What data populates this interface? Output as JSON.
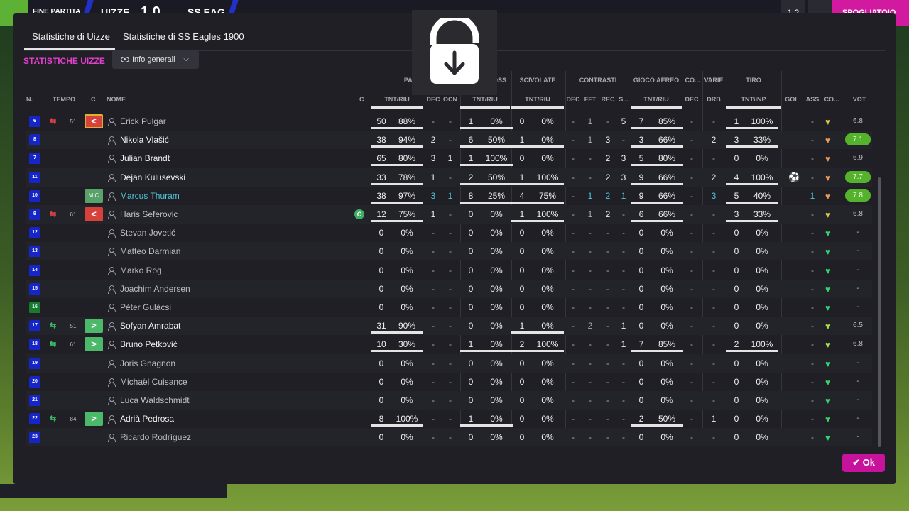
{
  "topbar": {
    "fine_partita": "FINE PARTITA",
    "home": "UIZZE",
    "score": "1 0",
    "away": "SS EAG",
    "right_btn1": "1 2",
    "right_btn2": "⌄",
    "right_label": "SPOGLIATOIO"
  },
  "tabs": [
    {
      "label": "Statistiche di Uizze"
    },
    {
      "label": "Statistiche di SS Eagles 1900"
    }
  ],
  "section_title": "STATISTICHE UIZZE",
  "view_dropdown": {
    "selected": "Info generali"
  },
  "column_groups": [
    "PASSAGG",
    "CROSS",
    "SCIVOLATE",
    "CONTRASTI",
    "GIOCO AEREO",
    "CO...",
    "VARIE",
    "TIRO"
  ],
  "columns": [
    "N.",
    "TEMPO",
    "C",
    "NOME",
    "C",
    "TNT/RIU",
    "DEC",
    "OCN",
    "TNT/RIU",
    "TNT/RIU",
    "DEC",
    "FFT",
    "REC",
    "S...",
    "TNT/RIU",
    "DEC",
    "DRB",
    "TNT\\INP",
    "GOL",
    "ASS",
    "CO...",
    "VOT"
  ],
  "players": [
    {
      "num": "6",
      "sub": "out",
      "time": "51",
      "chip": "<",
      "name": "Erick Pulgar",
      "pass": [
        "50",
        "88%"
      ],
      "dec": "-",
      "ocn": "-",
      "cross": [
        "1",
        "0%"
      ],
      "sciv": [
        "0",
        "0%"
      ],
      "cdec": "-",
      "fft": "1",
      "rec": "-",
      "s": "5",
      "aer": [
        "7",
        "85%"
      ],
      "codec": "-",
      "drb": "-",
      "tiro": [
        "1",
        "100%"
      ],
      "gol": "",
      "ass": "-",
      "rating": "6.8",
      "heart": "y"
    },
    {
      "num": "8",
      "sub": "",
      "time": "",
      "chip": "",
      "name": "Nikola Vlašić",
      "pass": [
        "38",
        "94%"
      ],
      "dec": "2",
      "ocn": "-",
      "cross": [
        "6",
        "50%"
      ],
      "sciv": [
        "1",
        "0%"
      ],
      "cdec": "-",
      "fft": "1",
      "rec": "3",
      "s": "-",
      "aer": [
        "3",
        "66%"
      ],
      "codec": "-",
      "drb": "2",
      "tiro": [
        "3",
        "33%"
      ],
      "gol": "",
      "ass": "-",
      "rating": "7.1",
      "heart": "o"
    },
    {
      "num": "7",
      "sub": "",
      "time": "",
      "chip": "",
      "name": "Julian Brandt",
      "pass": [
        "65",
        "80%"
      ],
      "dec": "3",
      "ocn": "1",
      "cross": [
        "1",
        "100%"
      ],
      "sciv": [
        "0",
        "0%"
      ],
      "cdec": "-",
      "fft": "-",
      "rec": "2",
      "s": "3",
      "aer": [
        "5",
        "80%"
      ],
      "codec": "-",
      "drb": "-",
      "tiro": [
        "0",
        "0%"
      ],
      "gol": "",
      "ass": "-",
      "rating": "6.9",
      "heart": "o"
    },
    {
      "num": "11",
      "sub": "",
      "time": "",
      "chip": "",
      "name": "Dejan Kulusevski",
      "pass": [
        "33",
        "78%"
      ],
      "dec": "1",
      "ocn": "-",
      "cross": [
        "2",
        "50%"
      ],
      "sciv": [
        "1",
        "100%"
      ],
      "cdec": "-",
      "fft": "-",
      "rec": "2",
      "s": "3",
      "aer": [
        "9",
        "66%"
      ],
      "codec": "-",
      "drb": "2",
      "tiro": [
        "4",
        "100%"
      ],
      "gol": "⚽",
      "ass": "-",
      "rating": "7.7",
      "heart": "o"
    },
    {
      "num": "10",
      "sub": "",
      "time": "",
      "chip": "MIC",
      "name": "Marcus Thuram",
      "pass": [
        "38",
        "97%"
      ],
      "dec": "3",
      "ocn": "1",
      "cross": [
        "8",
        "25%"
      ],
      "sciv": [
        "4",
        "75%"
      ],
      "cdec": "-",
      "fft": "1",
      "rec": "2",
      "s": "1",
      "aer": [
        "9",
        "66%"
      ],
      "codec": "-",
      "drb": "3",
      "tiro": [
        "5",
        "40%"
      ],
      "gol": "",
      "ass": "1",
      "rating": "7.8",
      "heart": "o"
    },
    {
      "num": "9",
      "sub": "out",
      "time": "61",
      "chip": "<",
      "name": "Haris Seferovic",
      "capt": "C",
      "pass": [
        "12",
        "75%"
      ],
      "dec": "1",
      "ocn": "-",
      "cross": [
        "0",
        "0%"
      ],
      "sciv": [
        "1",
        "100%"
      ],
      "cdec": "-",
      "fft": "1",
      "rec": "2",
      "s": "-",
      "aer": [
        "6",
        "66%"
      ],
      "codec": "-",
      "drb": "-",
      "tiro": [
        "3",
        "33%"
      ],
      "gol": "",
      "ass": "-",
      "rating": "6.8",
      "heart": "y"
    },
    {
      "num": "12",
      "sub": "",
      "time": "",
      "chip": "",
      "name": "Stevan Jovetić",
      "pass": [
        "0",
        "0%"
      ],
      "dec": "-",
      "ocn": "-",
      "cross": [
        "0",
        "0%"
      ],
      "sciv": [
        "0",
        "0%"
      ],
      "cdec": "-",
      "fft": "-",
      "rec": "-",
      "s": "-",
      "aer": [
        "0",
        "0%"
      ],
      "codec": "-",
      "drb": "-",
      "tiro": [
        "0",
        "0%"
      ],
      "gol": "",
      "ass": "-",
      "rating": "-",
      "heart": "g"
    },
    {
      "num": "13",
      "sub": "",
      "time": "",
      "chip": "",
      "name": "Matteo Darmian",
      "pass": [
        "0",
        "0%"
      ],
      "dec": "-",
      "ocn": "-",
      "cross": [
        "0",
        "0%"
      ],
      "sciv": [
        "0",
        "0%"
      ],
      "cdec": "-",
      "fft": "-",
      "rec": "-",
      "s": "-",
      "aer": [
        "0",
        "0%"
      ],
      "codec": "-",
      "drb": "-",
      "tiro": [
        "0",
        "0%"
      ],
      "gol": "",
      "ass": "-",
      "rating": "-",
      "heart": "g"
    },
    {
      "num": "14",
      "sub": "",
      "time": "",
      "chip": "",
      "name": "Marko Rog",
      "pass": [
        "0",
        "0%"
      ],
      "dec": "-",
      "ocn": "-",
      "cross": [
        "0",
        "0%"
      ],
      "sciv": [
        "0",
        "0%"
      ],
      "cdec": "-",
      "fft": "-",
      "rec": "-",
      "s": "-",
      "aer": [
        "0",
        "0%"
      ],
      "codec": "-",
      "drb": "-",
      "tiro": [
        "0",
        "0%"
      ],
      "gol": "",
      "ass": "-",
      "rating": "-",
      "heart": "g"
    },
    {
      "num": "15",
      "sub": "",
      "time": "",
      "chip": "",
      "name": "Joachim Andersen",
      "pass": [
        "0",
        "0%"
      ],
      "dec": "-",
      "ocn": "-",
      "cross": [
        "0",
        "0%"
      ],
      "sciv": [
        "0",
        "0%"
      ],
      "cdec": "-",
      "fft": "-",
      "rec": "-",
      "s": "-",
      "aer": [
        "0",
        "0%"
      ],
      "codec": "-",
      "drb": "-",
      "tiro": [
        "0",
        "0%"
      ],
      "gol": "",
      "ass": "-",
      "rating": "-",
      "heart": "g"
    },
    {
      "num": "16",
      "sub": "",
      "time": "",
      "chip": "",
      "name": "Péter Gulácsi",
      "gk": true,
      "pass": [
        "0",
        "0%"
      ],
      "dec": "-",
      "ocn": "-",
      "cross": [
        "0",
        "0%"
      ],
      "sciv": [
        "0",
        "0%"
      ],
      "cdec": "-",
      "fft": "-",
      "rec": "-",
      "s": "-",
      "aer": [
        "0",
        "0%"
      ],
      "codec": "-",
      "drb": "-",
      "tiro": [
        "0",
        "0%"
      ],
      "gol": "",
      "ass": "-",
      "rating": "-",
      "heart": "g"
    },
    {
      "num": "17",
      "sub": "in",
      "time": "51",
      "chip": ">",
      "name": "Sofyan Amrabat",
      "pass": [
        "31",
        "90%"
      ],
      "dec": "-",
      "ocn": "-",
      "cross": [
        "0",
        "0%"
      ],
      "sciv": [
        "1",
        "0%"
      ],
      "cdec": "-",
      "fft": "2",
      "rec": "-",
      "s": "1",
      "aer": [
        "0",
        "0%"
      ],
      "codec": "-",
      "drb": "-",
      "tiro": [
        "0",
        "0%"
      ],
      "gol": "",
      "ass": "-",
      "rating": "6.5",
      "heart": "lg"
    },
    {
      "num": "18",
      "sub": "in",
      "time": "61",
      "chip": ">",
      "name": "Bruno Petković",
      "pass": [
        "10",
        "30%"
      ],
      "dec": "-",
      "ocn": "-",
      "cross": [
        "1",
        "0%"
      ],
      "sciv": [
        "2",
        "100%"
      ],
      "cdec": "-",
      "fft": "-",
      "rec": "-",
      "s": "1",
      "aer": [
        "7",
        "85%"
      ],
      "codec": "-",
      "drb": "-",
      "tiro": [
        "2",
        "100%"
      ],
      "gol": "",
      "ass": "-",
      "rating": "6.8",
      "heart": "lg"
    },
    {
      "num": "19",
      "sub": "",
      "time": "",
      "chip": "",
      "name": "Joris Gnagnon",
      "pass": [
        "0",
        "0%"
      ],
      "dec": "-",
      "ocn": "-",
      "cross": [
        "0",
        "0%"
      ],
      "sciv": [
        "0",
        "0%"
      ],
      "cdec": "-",
      "fft": "-",
      "rec": "-",
      "s": "-",
      "aer": [
        "0",
        "0%"
      ],
      "codec": "-",
      "drb": "-",
      "tiro": [
        "0",
        "0%"
      ],
      "gol": "",
      "ass": "-",
      "rating": "-",
      "heart": "g"
    },
    {
      "num": "20",
      "sub": "",
      "time": "",
      "chip": "",
      "name": "Michaël Cuisance",
      "pass": [
        "0",
        "0%"
      ],
      "dec": "-",
      "ocn": "-",
      "cross": [
        "0",
        "0%"
      ],
      "sciv": [
        "0",
        "0%"
      ],
      "cdec": "-",
      "fft": "-",
      "rec": "-",
      "s": "-",
      "aer": [
        "0",
        "0%"
      ],
      "codec": "-",
      "drb": "-",
      "tiro": [
        "0",
        "0%"
      ],
      "gol": "",
      "ass": "-",
      "rating": "-",
      "heart": "g"
    },
    {
      "num": "21",
      "sub": "",
      "time": "",
      "chip": "",
      "name": "Luca Waldschmidt",
      "pass": [
        "0",
        "0%"
      ],
      "dec": "-",
      "ocn": "-",
      "cross": [
        "0",
        "0%"
      ],
      "sciv": [
        "0",
        "0%"
      ],
      "cdec": "-",
      "fft": "-",
      "rec": "-",
      "s": "-",
      "aer": [
        "0",
        "0%"
      ],
      "codec": "-",
      "drb": "-",
      "tiro": [
        "0",
        "0%"
      ],
      "gol": "",
      "ass": "-",
      "rating": "-",
      "heart": "g"
    },
    {
      "num": "22",
      "sub": "in",
      "time": "84",
      "chip": ">",
      "name": "Adrià Pedrosa",
      "pass": [
        "8",
        "100%"
      ],
      "dec": "-",
      "ocn": "-",
      "cross": [
        "1",
        "0%"
      ],
      "sciv": [
        "0",
        "0%"
      ],
      "cdec": "-",
      "fft": "-",
      "rec": "-",
      "s": "-",
      "aer": [
        "2",
        "50%"
      ],
      "codec": "-",
      "drb": "1",
      "tiro": [
        "0",
        "0%"
      ],
      "gol": "",
      "ass": "-",
      "rating": "-",
      "heart": "g"
    },
    {
      "num": "23",
      "sub": "",
      "time": "",
      "chip": "",
      "name": "Ricardo Rodríguez",
      "pass": [
        "0",
        "0%"
      ],
      "dec": "-",
      "ocn": "-",
      "cross": [
        "0",
        "0%"
      ],
      "sciv": [
        "0",
        "0%"
      ],
      "cdec": "-",
      "fft": "-",
      "rec": "-",
      "s": "-",
      "aer": [
        "0",
        "0%"
      ],
      "codec": "-",
      "drb": "-",
      "tiro": [
        "0",
        "0%"
      ],
      "gol": "",
      "ass": "-",
      "rating": "-",
      "heart": "g"
    }
  ],
  "ok_button": {
    "label": "Ok",
    "icon": "check-icon"
  },
  "overlay_icon": "unlock-download-icon",
  "colors": {
    "accent": "#e23fcc",
    "ok": "#c7139c",
    "highlight": "#4ec7da",
    "top_rating": "#54b22d"
  }
}
